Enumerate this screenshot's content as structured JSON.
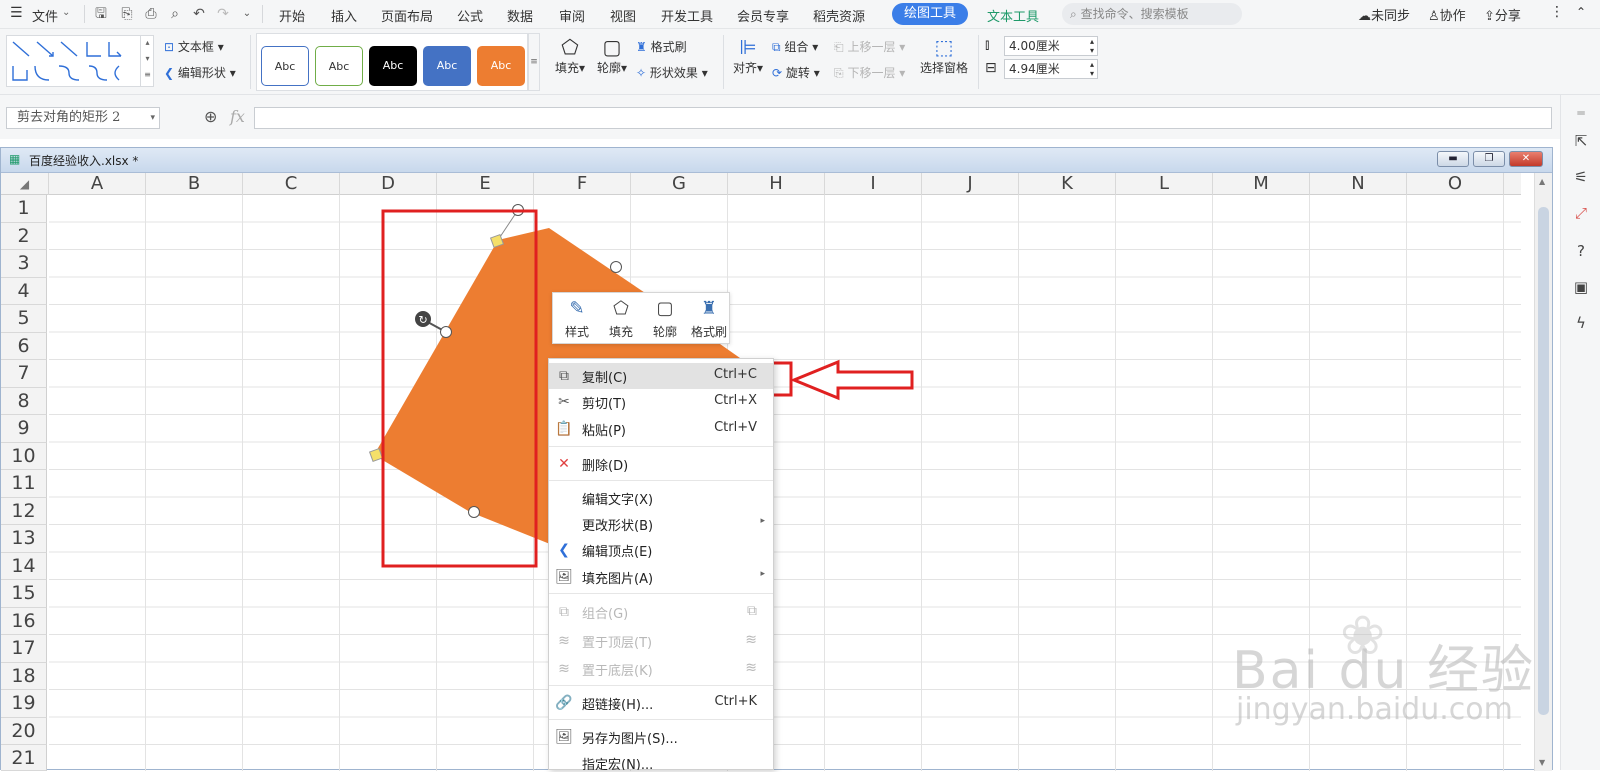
{
  "menubar": {
    "file_label": "文件",
    "tabs": [
      "开始",
      "插入",
      "页面布局",
      "公式",
      "数据",
      "审阅",
      "视图",
      "开发工具",
      "会员专享",
      "稻壳资源"
    ],
    "active_tab": "绘图工具",
    "text_tool_tab": "文本工具",
    "search_placeholder": "查找命令、搜索模板",
    "sync_label": "未同步",
    "collab_label": "协作",
    "share_label": "分享"
  },
  "ribbon": {
    "textbox_label": "文本框",
    "edit_shape_label": "编辑形状",
    "style_swatch_text": "Abc",
    "style_colors": [
      "#ffffff",
      "#ffffff",
      "#000000",
      "#4472c4",
      "#ed7d31"
    ],
    "fill_label": "填充",
    "outline_label": "轮廓",
    "format_painter_label": "格式刷",
    "shape_effect_label": "形状效果",
    "align_label": "对齐",
    "group_label": "组合",
    "rotate_label": "旋转",
    "bring_forward_label": "上移一层",
    "send_backward_label": "下移一层",
    "selection_pane_label": "选择窗格",
    "height_value": "4.00厘米",
    "width_value": "4.94厘米"
  },
  "formula_bar": {
    "name_box": "剪去对角的矩形 2",
    "fx_label": "fx",
    "formula_value": ""
  },
  "workbook": {
    "title": "百度经验收入.xlsx *",
    "columns": [
      "A",
      "B",
      "C",
      "D",
      "E",
      "F",
      "G",
      "H",
      "I",
      "J",
      "K",
      "L",
      "M",
      "N",
      "O"
    ],
    "rows": [
      "1",
      "2",
      "3",
      "4",
      "5",
      "6",
      "7",
      "8",
      "9",
      "10",
      "11",
      "12",
      "13",
      "14",
      "15",
      "16",
      "17",
      "18",
      "19",
      "20",
      "21"
    ]
  },
  "shape": {
    "fill_color": "#ed7d31"
  },
  "mini_toolbar": {
    "items": [
      "样式",
      "填充",
      "轮廓",
      "格式刷"
    ]
  },
  "context_menu": {
    "items": [
      {
        "label": "复制(C)",
        "shortcut": "Ctrl+C",
        "icon": "copy-icon",
        "disabled": false
      },
      {
        "label": "剪切(T)",
        "shortcut": "Ctrl+X",
        "icon": "cut-icon",
        "disabled": false
      },
      {
        "label": "粘贴(P)",
        "shortcut": "Ctrl+V",
        "icon": "paste-icon",
        "disabled": false
      },
      {
        "label": "删除(D)",
        "shortcut": "",
        "icon": "delete-icon",
        "disabled": false
      },
      {
        "label": "编辑文字(X)",
        "shortcut": "",
        "icon": "",
        "disabled": false
      },
      {
        "label": "更改形状(B)",
        "shortcut": "",
        "icon": "",
        "disabled": false
      },
      {
        "label": "编辑顶点(E)",
        "shortcut": "",
        "icon": "edit-points-icon",
        "disabled": false
      },
      {
        "label": "填充图片(A)",
        "shortcut": "",
        "icon": "fill-picture-icon",
        "disabled": false
      },
      {
        "label": "组合(G)",
        "shortcut": "",
        "icon": "group-icon",
        "disabled": true
      },
      {
        "label": "置于顶层(T)",
        "shortcut": "",
        "icon": "bring-to-front-icon",
        "disabled": true
      },
      {
        "label": "置于底层(K)",
        "shortcut": "",
        "icon": "send-to-back-icon",
        "disabled": true
      },
      {
        "label": "超链接(H)...",
        "shortcut": "Ctrl+K",
        "icon": "hyperlink-icon",
        "disabled": false
      },
      {
        "label": "另存为图片(S)...",
        "shortcut": "",
        "icon": "save-as-picture-icon",
        "disabled": false
      },
      {
        "label": "指定宏(N)...",
        "shortcut": "",
        "icon": "",
        "disabled": false
      }
    ]
  },
  "annotation": {
    "highlight_color": "#e02020"
  },
  "watermark": {
    "brand": "Bai du 经验",
    "url": "jingyan.baidu.com"
  }
}
